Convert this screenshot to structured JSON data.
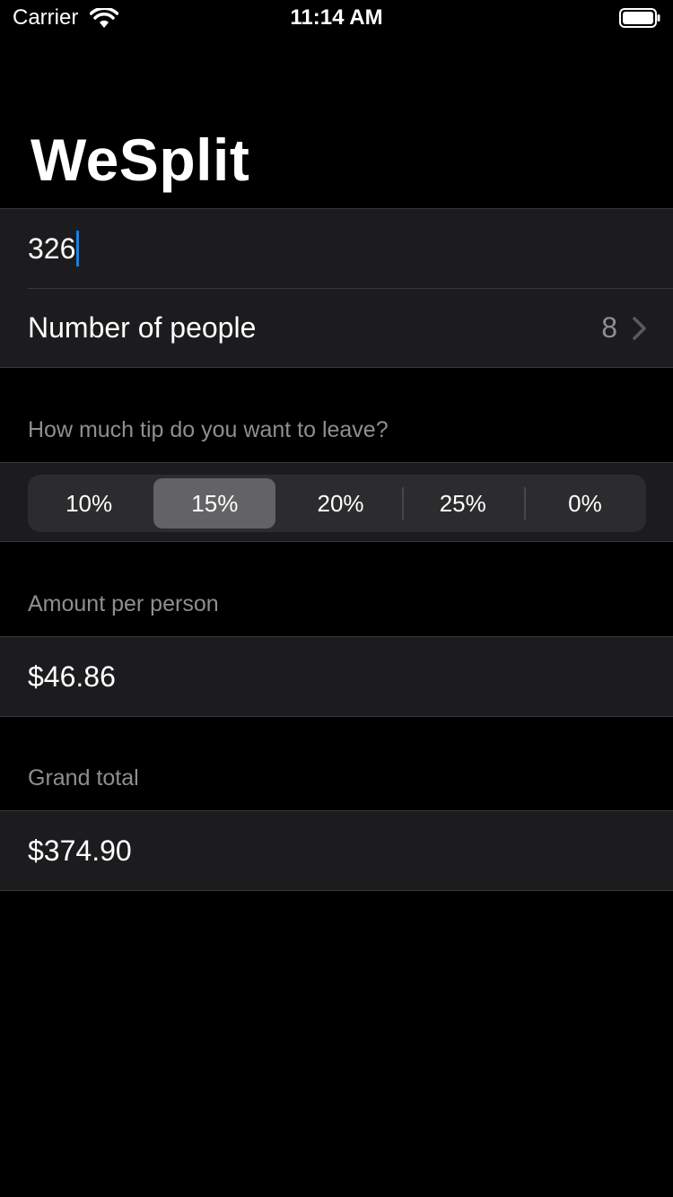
{
  "status_bar": {
    "carrier": "Carrier",
    "time": "11:14 AM"
  },
  "title": "WeSplit",
  "form": {
    "amount_value": "326",
    "people_label": "Number of people",
    "people_value": "8"
  },
  "tip": {
    "header": "How much tip do you want to leave?",
    "options": [
      "10%",
      "15%",
      "20%",
      "25%",
      "0%"
    ],
    "selected": "15%"
  },
  "per_person": {
    "header": "Amount per person",
    "value": "$46.86"
  },
  "grand_total": {
    "header": "Grand total",
    "value": "$374.90"
  },
  "colors": {
    "background": "#000000",
    "cell": "#1c1c1e",
    "accent": "#0a84ff",
    "secondary_text": "#8e8e93",
    "segment_selected": "#636366"
  },
  "icons": [
    "wifi-icon",
    "battery-icon",
    "chevron-right-icon"
  ]
}
